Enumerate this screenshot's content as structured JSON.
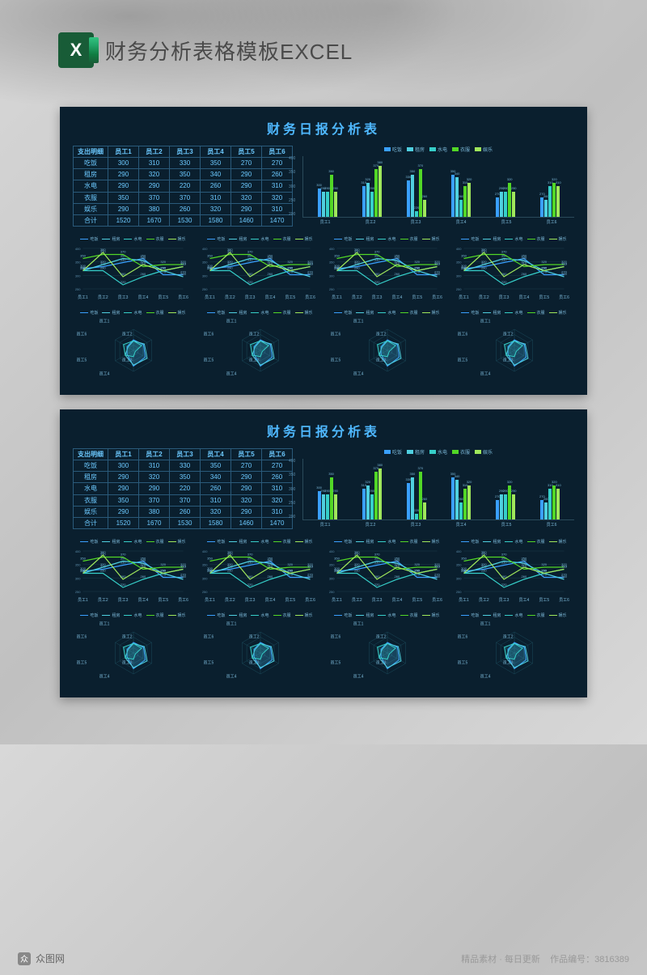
{
  "header": {
    "icon_letter": "X",
    "title": "财务分析表格模板EXCEL"
  },
  "dashboard": {
    "title": "财务日报分析表",
    "table": {
      "header_row": [
        "支出明细",
        "员工1",
        "员工2",
        "员工3",
        "员工4",
        "员工5",
        "员工6"
      ],
      "rows": [
        [
          "吃饭",
          "300",
          "310",
          "330",
          "350",
          "270",
          "270"
        ],
        [
          "租房",
          "290",
          "320",
          "350",
          "340",
          "290",
          "260"
        ],
        [
          "水电",
          "290",
          "290",
          "220",
          "260",
          "290",
          "310"
        ],
        [
          "衣服",
          "350",
          "370",
          "370",
          "310",
          "320",
          "320"
        ],
        [
          "娱乐",
          "290",
          "380",
          "260",
          "320",
          "290",
          "310"
        ],
        [
          "合计",
          "1520",
          "1670",
          "1530",
          "1580",
          "1460",
          "1470"
        ]
      ]
    },
    "legend_categories": [
      "吃饭",
      "租房",
      "水电",
      "衣服",
      "娱乐"
    ],
    "colors": {
      "c1": "#3aa0ff",
      "c2": "#4fd0e0",
      "c3": "#36cfc9",
      "c4": "#52d726",
      "c5": "#a0e85b"
    },
    "employees": [
      "员工1",
      "员工2",
      "员工3",
      "员工4",
      "员工5",
      "员工6"
    ],
    "y_ticks": [
      "400",
      "350",
      "300",
      "250",
      "200"
    ]
  },
  "chart_data": {
    "type": "bar",
    "title": "财务日报分析表",
    "xlabel": "",
    "ylabel": "",
    "ylim": [
      200,
      400
    ],
    "categories": [
      "员工1",
      "员工2",
      "员工3",
      "员工4",
      "员工5",
      "员工6"
    ],
    "series": [
      {
        "name": "吃饭",
        "values": [
          300,
          310,
          330,
          350,
          270,
          270
        ]
      },
      {
        "name": "租房",
        "values": [
          290,
          320,
          350,
          340,
          290,
          260
        ]
      },
      {
        "name": "水电",
        "values": [
          290,
          290,
          220,
          260,
          290,
          310
        ]
      },
      {
        "name": "衣服",
        "values": [
          350,
          370,
          370,
          310,
          320,
          320
        ]
      },
      {
        "name": "娱乐",
        "values": [
          290,
          380,
          260,
          320,
          290,
          310
        ]
      }
    ],
    "sub_line_charts": 4,
    "sub_radar_charts": 4
  },
  "watermark": {
    "site": "众图网",
    "tagline": "精品素材 · 每日更新",
    "id_label": "作品编号：3816389"
  }
}
